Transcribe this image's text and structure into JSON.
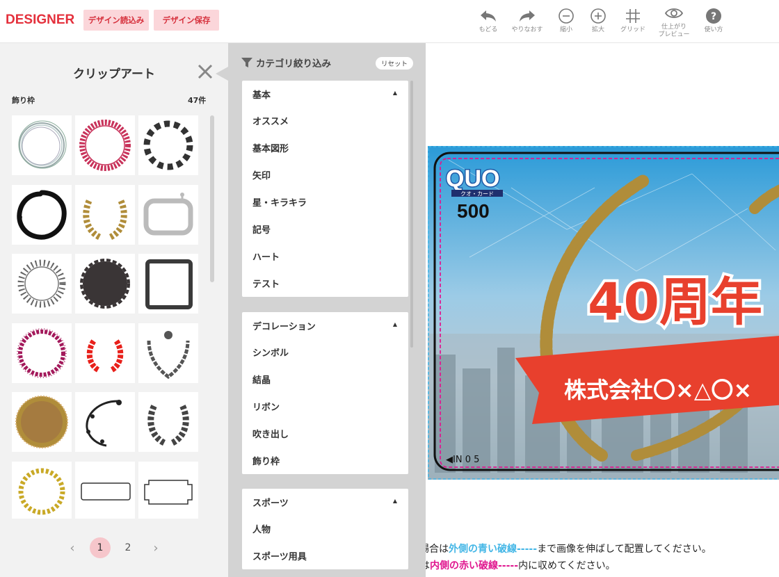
{
  "header": {
    "logo": "DESIGNER",
    "load_label": "デザイン読込み",
    "save_label": "デザイン保存",
    "tools": [
      {
        "icon": "undo-icon",
        "label": "もどる"
      },
      {
        "icon": "redo-icon",
        "label": "やりなおす"
      },
      {
        "icon": "zoom-out-icon",
        "label": "縮小"
      },
      {
        "icon": "zoom-in-icon",
        "label": "拡大"
      },
      {
        "icon": "grid-icon",
        "label": "グリッド"
      },
      {
        "icon": "eye-icon",
        "label": "仕上がり\nプレビュー"
      },
      {
        "icon": "help-icon",
        "label": "使い方"
      }
    ]
  },
  "clipart": {
    "title": "クリップアート",
    "category": "飾り枠",
    "count": "47件",
    "items": [
      "frame-wreath-icon",
      "frame-greek-icon",
      "frame-checker-icon",
      "frame-brush-icon",
      "frame-laurel-gold-icon",
      "frame-rounded-icon",
      "frame-people-icon",
      "frame-scallop-icon",
      "frame-square-brush-icon",
      "frame-lace-icon",
      "frame-red-leaf-icon",
      "frame-ornate-shield-icon",
      "frame-circle-pattern-icon",
      "frame-floral-icon",
      "frame-laurel-gray-icon",
      "frame-yellow-wreath-icon",
      "frame-rect-icon",
      "frame-ticket-icon"
    ],
    "pager": {
      "prev": "‹",
      "pages": [
        "1",
        "2"
      ],
      "current": "1",
      "next": "›"
    }
  },
  "filter": {
    "title": "カテゴリ絞り込み",
    "reset": "リセット",
    "groups": [
      {
        "name": "基本",
        "items": [
          "オススメ",
          "基本図形",
          "矢印",
          "星・キラキラ",
          "記号",
          "ハート",
          "テスト"
        ]
      },
      {
        "name": "デコレーション",
        "items": [
          "シンボル",
          "結晶",
          "リボン",
          "吹き出し",
          "飾り枠"
        ]
      },
      {
        "name": "スポーツ",
        "items": [
          "人物",
          "スポーツ用具"
        ]
      }
    ]
  },
  "card": {
    "brand": "QUO",
    "brand_sub": "クオ・カード",
    "value": "500",
    "headline": "40周年",
    "ribbon": "株式会社〇×△〇×",
    "code": "◀IN  0  5"
  },
  "notes": {
    "line1_pre": "要な場合は",
    "line1_em": "外側の青い破線-----",
    "line1_post": "まで画像を伸ばして配置してください。",
    "line2_pre": "柄は",
    "line2_em": "内側の赤い破線-----",
    "line2_post": "内に収めてください。"
  },
  "colors": {
    "accent": "#e4303c",
    "button_bg": "#fbd6da",
    "blue_guide": "#43b6e6",
    "red_guide": "#e0178f",
    "ribbon": "#e8402d",
    "laurel": "#b08d3a"
  }
}
